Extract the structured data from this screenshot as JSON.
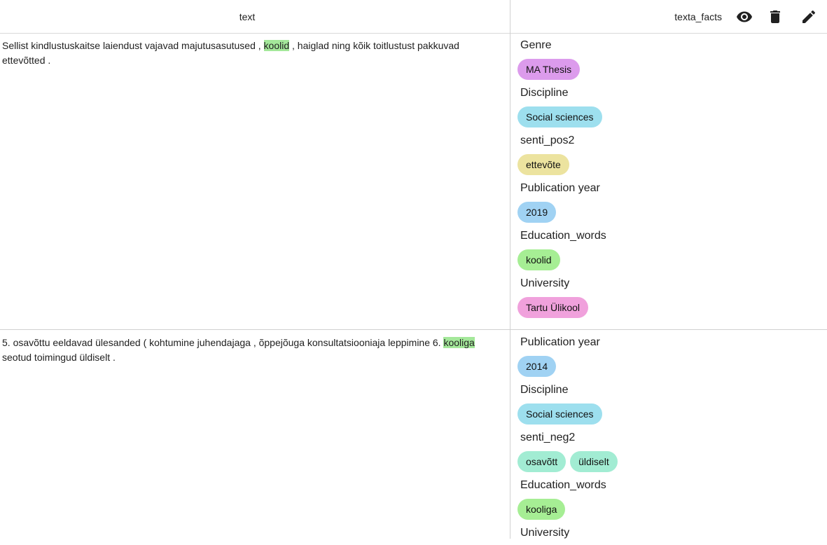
{
  "header": {
    "text_col": "text",
    "facts_col": "texta_facts",
    "icons": [
      "eye-icon",
      "trash-icon",
      "pencil-icon"
    ]
  },
  "colors": {
    "genre": "#dc9bec",
    "discipline": "#9ddfee",
    "senti": "#ece39f",
    "senti_neg": "#a2ecd3",
    "year": "#a0d2f3",
    "education": "#a6ee94",
    "university": "#f0a1dc",
    "highlight": "#a4e89a"
  },
  "rows": [
    {
      "text_before": "Sellist kindlustuskaitse laiendust vajavad majutusasutused , ",
      "text_highlight": "koolid",
      "text_after": " , haiglad ning kõik toitlustust pakkuvad ettevõtted .",
      "facts": [
        {
          "name": "Genre",
          "values": [
            "MA Thesis"
          ]
        },
        {
          "name": "Discipline",
          "values": [
            "Social sciences"
          ]
        },
        {
          "name": "senti_pos2",
          "values": [
            "ettevõte"
          ]
        },
        {
          "name": "Publication year",
          "values": [
            "2019"
          ]
        },
        {
          "name": "Education_words",
          "values": [
            "koolid"
          ]
        },
        {
          "name": "University",
          "values": [
            "Tartu Ülikool"
          ]
        }
      ]
    },
    {
      "text_before": "5. osavõttu eeldavad ülesanded ( kohtumine juhendajaga , õppejõuga konsultatsiooniaja leppimine 6. ",
      "text_highlight": "kooliga",
      "text_after": " seotud toimingud üldiselt .",
      "facts": [
        {
          "name": "Publication year",
          "values": [
            "2014"
          ]
        },
        {
          "name": "Discipline",
          "values": [
            "Social sciences"
          ]
        },
        {
          "name": "senti_neg2",
          "values": [
            "osavõtt",
            "üldiselt"
          ]
        },
        {
          "name": "Education_words",
          "values": [
            "kooliga"
          ]
        },
        {
          "name": "University",
          "values": []
        }
      ]
    }
  ]
}
